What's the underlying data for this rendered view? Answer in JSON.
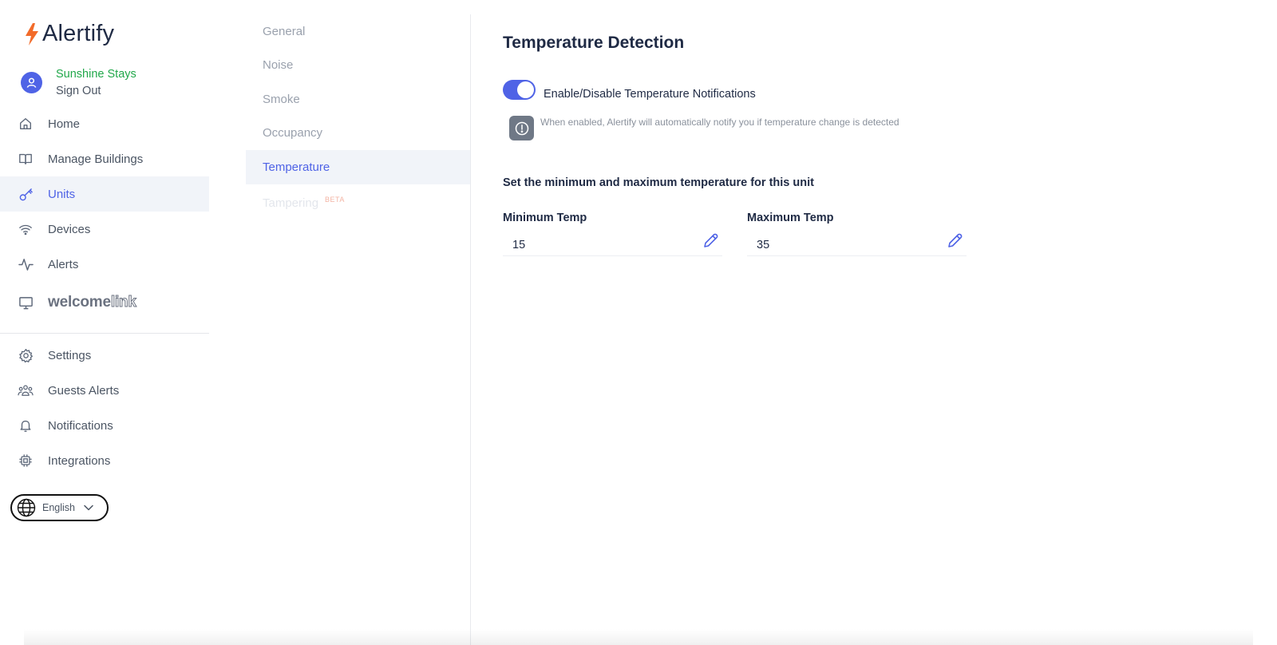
{
  "app": {
    "logo_text": "Alertify",
    "brand_color": "#4f63e6",
    "logo_bolt_color": "#f26b2a"
  },
  "profile": {
    "name": "Sunshine Stays",
    "signout": "Sign Out"
  },
  "sidebar": {
    "items": [
      {
        "label": "Home",
        "icon": "home-icon"
      },
      {
        "label": "Manage Buildings",
        "icon": "book-icon"
      },
      {
        "label": "Units",
        "icon": "key-icon",
        "active": true
      },
      {
        "label": "Devices",
        "icon": "wifi-icon"
      },
      {
        "label": "Alerts",
        "icon": "activity-icon"
      }
    ],
    "welcome": {
      "brand_main": "welcome",
      "brand_link": "link",
      "icon": "monitor-icon"
    },
    "secondary": [
      {
        "label": "Settings",
        "icon": "gear-icon"
      },
      {
        "label": "Guests Alerts",
        "icon": "users-icon"
      },
      {
        "label": "Notifications",
        "icon": "bell-icon"
      },
      {
        "label": "Integrations",
        "icon": "chip-icon"
      }
    ],
    "language": {
      "selected": "English",
      "icon": "globe-icon"
    }
  },
  "submenu": {
    "items": [
      {
        "label": "General"
      },
      {
        "label": "Noise"
      },
      {
        "label": "Smoke"
      },
      {
        "label": "Occupancy"
      },
      {
        "label": "Temperature",
        "active": true
      },
      {
        "label": "Tampering",
        "badge": "BETA",
        "disabled": true
      }
    ]
  },
  "main": {
    "title": "Temperature Detection",
    "toggle": {
      "label": "Enable/Disable Temperature Notifications",
      "enabled": true
    },
    "info": "When enabled, Alertify will automatically notify you if temperature change is detected",
    "range_label": "Set the minimum and maximum temperature for this unit",
    "min": {
      "label": "Minimum Temp",
      "value": "15"
    },
    "max": {
      "label": "Maximum Temp",
      "value": "35"
    }
  }
}
